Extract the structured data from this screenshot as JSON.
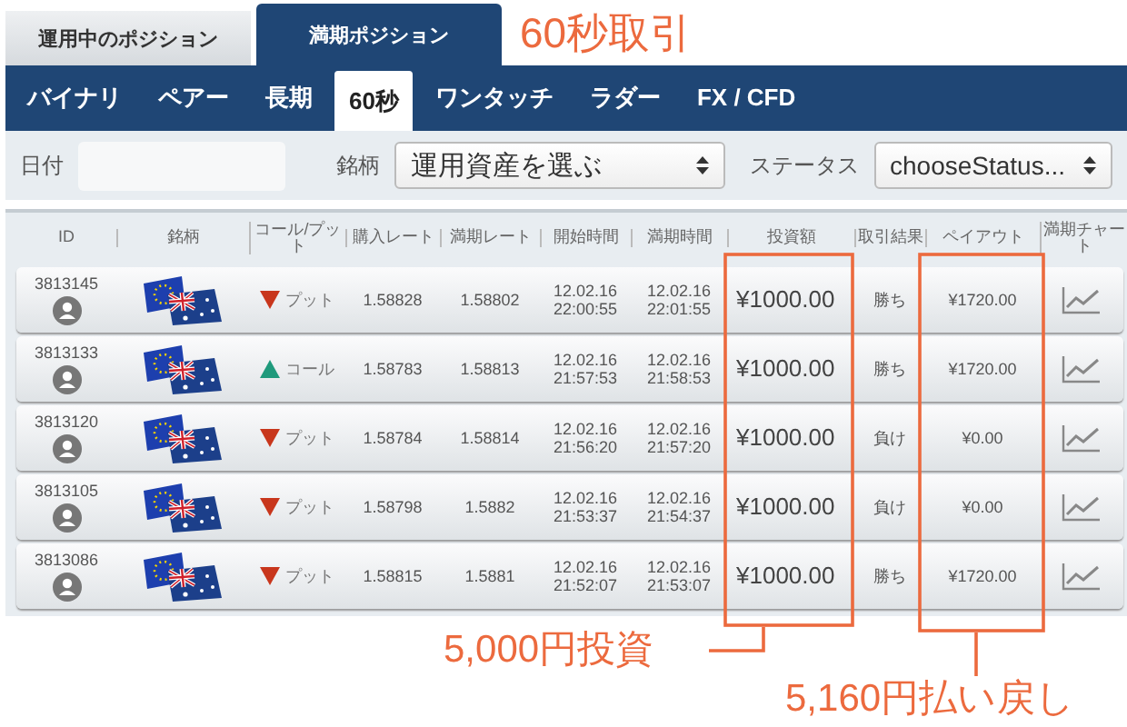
{
  "top_tabs": [
    {
      "label": "運用中のポジション",
      "selected": false
    },
    {
      "label": "満期ポジション",
      "selected": true
    }
  ],
  "page_title": "60秒取引",
  "nav": [
    {
      "label": "バイナリ",
      "selected": false
    },
    {
      "label": "ペアー",
      "selected": false
    },
    {
      "label": "長期",
      "selected": false
    },
    {
      "label": "60秒",
      "selected": true
    },
    {
      "label": "ワンタッチ",
      "selected": false
    },
    {
      "label": "ラダー",
      "selected": false
    },
    {
      "label": "FX / CFD",
      "selected": false
    }
  ],
  "filters": {
    "date_label": "日付",
    "asset_label": "銘柄",
    "asset_value": "運用資産を選ぶ",
    "status_label": "ステータス",
    "status_value": "chooseStatus..."
  },
  "table": {
    "columns": [
      "ID",
      "銘柄",
      "コール/プット",
      "購入レート",
      "満期レート",
      "開始時間",
      "満期時間",
      "投資額",
      "取引結果",
      "ペイアウト",
      "満期チャート"
    ],
    "rows": [
      {
        "id": "3813145",
        "kind": "put",
        "direction": "プット",
        "buy_rate": "1.58828",
        "expiry_rate": "1.58802",
        "start_date": "12.02.16",
        "start_time": "22:00:55",
        "end_date": "12.02.16",
        "end_time": "22:01:55",
        "amount": "¥1000.00",
        "result": "勝ち",
        "payout": "¥1720.00"
      },
      {
        "id": "3813133",
        "kind": "call",
        "direction": "コール",
        "buy_rate": "1.58783",
        "expiry_rate": "1.58813",
        "start_date": "12.02.16",
        "start_time": "21:57:53",
        "end_date": "12.02.16",
        "end_time": "21:58:53",
        "amount": "¥1000.00",
        "result": "勝ち",
        "payout": "¥1720.00"
      },
      {
        "id": "3813120",
        "kind": "put",
        "direction": "プット",
        "buy_rate": "1.58784",
        "expiry_rate": "1.58814",
        "start_date": "12.02.16",
        "start_time": "21:56:20",
        "end_date": "12.02.16",
        "end_time": "21:57:20",
        "amount": "¥1000.00",
        "result": "負け",
        "payout": "¥0.00"
      },
      {
        "id": "3813105",
        "kind": "put",
        "direction": "プット",
        "buy_rate": "1.58798",
        "expiry_rate": "1.5882",
        "start_date": "12.02.16",
        "start_time": "21:53:37",
        "end_date": "12.02.16",
        "end_time": "21:54:37",
        "amount": "¥1000.00",
        "result": "負け",
        "payout": "¥0.00"
      },
      {
        "id": "3813086",
        "kind": "put",
        "direction": "プット",
        "buy_rate": "1.58815",
        "expiry_rate": "1.5881",
        "start_date": "12.02.16",
        "start_time": "21:52:07",
        "end_date": "12.02.16",
        "end_time": "21:53:07",
        "amount": "¥1000.00",
        "result": "勝ち",
        "payout": "¥1720.00"
      }
    ]
  },
  "callouts": [
    "5,000円投資",
    "5,160円払い戻し"
  ]
}
